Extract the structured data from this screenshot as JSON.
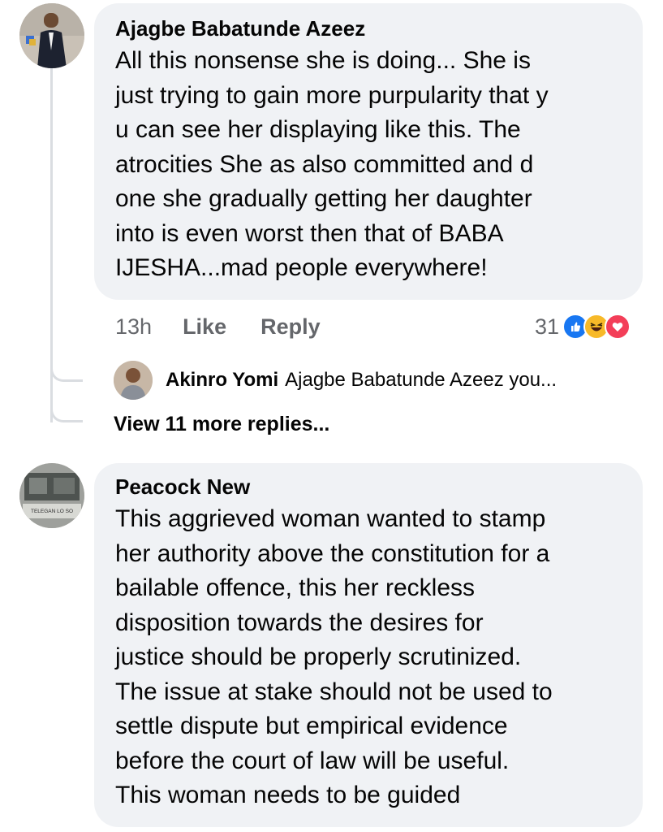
{
  "comment1": {
    "author": "Ajagbe Babatunde Azeez",
    "text": "All this nonsense she is doing... She is\njust trying to gain more purpularity that y\nu can see her displaying like this. The\natrocities She as also committed and d\none she gradually  getting her daughter\ninto is even worst then that of BABA\nIJESHA...mad people everywhere!",
    "time": "13h",
    "like_label": "Like",
    "reply_label": "Reply",
    "reaction_count": "31",
    "reactions": [
      "like-icon",
      "haha-icon",
      "love-icon"
    ]
  },
  "reply_preview": {
    "author": "Akinro Yomi",
    "snippet": "Ajagbe Babatunde Azeez you..."
  },
  "view_more_label": "View 11 more replies...",
  "comment2": {
    "author": "Peacock New",
    "text": "This aggrieved woman wanted to stamp\nher authority above the constitution for a\nbailable offence, this her reckless\ndisposition towards the desires for\njustice should be properly scrutinized.\nThe issue at stake should not be used to\nsettle dispute but empirical evidence\nbefore the court of law will be useful.\nThis woman needs to be guided",
    "avatar_text": "TELEGAN LO SO"
  },
  "colors": {
    "bubble": "#f0f2f5",
    "meta_text": "#65676b",
    "like_blue": "#1877f2",
    "haha_yellow": "#f7b928",
    "love_red": "#f33e58"
  }
}
